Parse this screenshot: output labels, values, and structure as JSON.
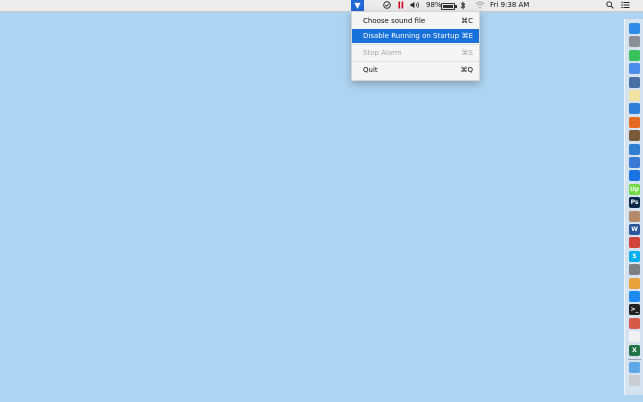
{
  "menubar": {
    "apple_glyph": "",
    "app_icon_glyph": "▼",
    "battery_percent": "98%",
    "battery_level": 0.98,
    "clock": "Fri 9:38 AM"
  },
  "dropdown": {
    "items": [
      {
        "label": "Choose sound file",
        "shortcut": "⌘C",
        "state": "normal"
      },
      {
        "label": "Disable Running on Startup",
        "shortcut": "⌘E",
        "state": "selected"
      },
      {
        "label": "Stop Alarm",
        "shortcut": "⌘S",
        "state": "disabled"
      },
      {
        "label": "Quit",
        "shortcut": "⌘Q",
        "state": "normal"
      }
    ]
  },
  "dock": {
    "icons": [
      {
        "name": "finder-icon",
        "color": "#2e8ce6",
        "glyph": ""
      },
      {
        "name": "safari-icon",
        "color": "#8a8f96",
        "glyph": ""
      },
      {
        "name": "messages-icon",
        "color": "#39c15b",
        "glyph": ""
      },
      {
        "name": "chrome-icon",
        "color": "#4b8de8",
        "glyph": ""
      },
      {
        "name": "preview-icon",
        "color": "#4a6fa5",
        "glyph": ""
      },
      {
        "name": "notes-icon",
        "color": "#f3e3a3",
        "glyph": ""
      },
      {
        "name": "compass-icon",
        "color": "#2f7fd6",
        "glyph": ""
      },
      {
        "name": "firefox-icon",
        "color": "#e66a1f",
        "glyph": ""
      },
      {
        "name": "photo-icon",
        "color": "#7a5a3a",
        "glyph": ""
      },
      {
        "name": "xcode-icon",
        "color": "#2e7fd0",
        "glyph": ""
      },
      {
        "name": "pen-icon",
        "color": "#3a7ad6",
        "glyph": ""
      },
      {
        "name": "teamviewer-icon",
        "color": "#1b74e4",
        "glyph": ""
      },
      {
        "name": "upwork-icon",
        "color": "#6fda44",
        "glyph": "Up"
      },
      {
        "name": "photoshop-icon",
        "color": "#0b2a4a",
        "glyph": "Ps"
      },
      {
        "name": "figure-icon",
        "color": "#b48a6a",
        "glyph": ""
      },
      {
        "name": "word-icon",
        "color": "#2b579a",
        "glyph": "W"
      },
      {
        "name": "red-app-icon",
        "color": "#d0453a",
        "glyph": ""
      },
      {
        "name": "skype-icon",
        "color": "#00aff0",
        "glyph": "S"
      },
      {
        "name": "system-preferences-icon",
        "color": "#7d7f83",
        "glyph": ""
      },
      {
        "name": "photos-icon",
        "color": "#e9a13a",
        "glyph": ""
      },
      {
        "name": "app-store-icon",
        "color": "#1d8cf0",
        "glyph": ""
      },
      {
        "name": "terminal-icon",
        "color": "#222222",
        "glyph": ">_"
      },
      {
        "name": "chart-app-icon",
        "color": "#d65a4a",
        "glyph": ""
      },
      {
        "name": "calendar-icon",
        "color": "#f2f2f2",
        "glyph": ""
      },
      {
        "name": "excel-icon",
        "color": "#217346",
        "glyph": "X"
      },
      {
        "name": "folder-icon",
        "color": "#5fa8e8",
        "glyph": ""
      },
      {
        "name": "trash-icon",
        "color": "#c9cdd2",
        "glyph": ""
      }
    ]
  }
}
